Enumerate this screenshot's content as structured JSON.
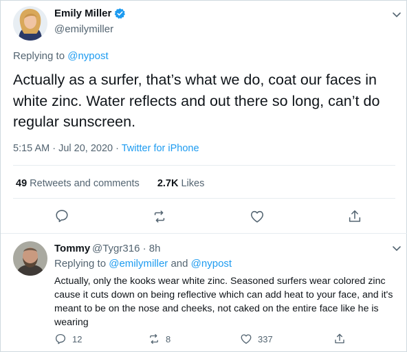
{
  "main_tweet": {
    "author_name": "Emily Miller",
    "handle": "@emilymiller",
    "replying_prefix": "Replying to ",
    "replying_to": "@nypost",
    "text": "Actually as a surfer, that’s what we do, coat our faces in white zinc. Water reflects and out there so long, can’t do regular sunscreen.",
    "timestamp": "5:15 AM · Jul 20, 2020 · ",
    "source": "Twitter for iPhone",
    "retweets_count": "49",
    "retweets_label": " Retweets and comments",
    "likes_count": "2.7K",
    "likes_label": " Likes"
  },
  "reply_tweet": {
    "author_name": "Tommy",
    "handle": "@Tygr316 · 8h",
    "replying_prefix": "Replying to ",
    "replying_to_1": "@emilymiller",
    "replying_and": " and ",
    "replying_to_2": "@nypost",
    "text": "Actually, only the kooks wear white zinc. Seasoned surfers wear colored zinc cause it cuts down on being reflective which can add heat to your face, and it's meant to be on the nose and cheeks, not caked on the entire face like he is wearing",
    "reply_count": "12",
    "retweet_count": "8",
    "like_count": "337"
  },
  "icons": {
    "verified": "verified-badge-icon",
    "caret": "chevron-down-icon",
    "reply": "reply-icon",
    "retweet": "retweet-icon",
    "like": "heart-icon",
    "share": "share-icon"
  },
  "colors": {
    "link": "#1d9bf0",
    "secondary_text": "#536471",
    "primary_text": "#0f1419",
    "divider": "#e6ecf0"
  }
}
